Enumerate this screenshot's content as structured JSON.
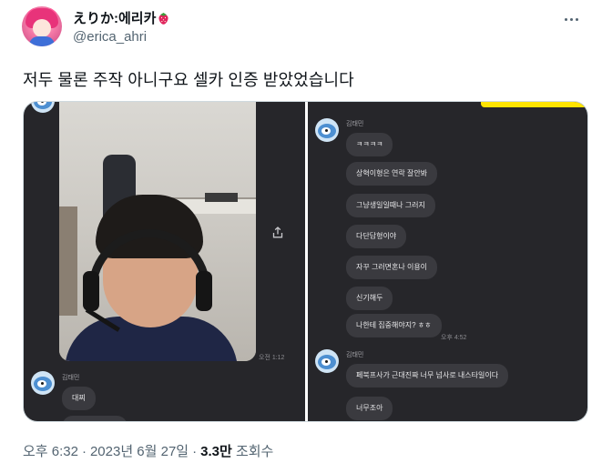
{
  "author": {
    "display_name": "えりか:에리카",
    "handle": "@erica_ahri"
  },
  "tweet": {
    "text": "저두 물론 주작 아니구요 셀카 인증 받았었습니다"
  },
  "media": {
    "left_panel": {
      "photo_timestamp": "오전 1:12",
      "sender_name": "김태민",
      "bubbles": [
        "대찌"
      ]
    },
    "right_panel": {
      "first_sender_name": "김태민",
      "first_group": [
        "ㅋㅋㅋㅋ",
        "상혁이형은 연락 잘안봐",
        "그냥생일일때나 그러지",
        "다단답형이야",
        "자꾸 그러면혼나 이용이",
        "신기해두",
        "나한테 집중해야지? ㅎㅎ"
      ],
      "first_group_time": "오후 4:52",
      "second_sender_name": "김태민",
      "second_group": [
        "페북프사가 근대진짜 너무 넘사로 내스타일이다",
        "너무조아"
      ]
    }
  },
  "footer": {
    "time": "오후 6:32",
    "date": "2023년 6월 27일",
    "views_count": "3.3만",
    "views_label": "조회수"
  },
  "colors": {
    "accent_yellow": "#ffe400",
    "chat_bg": "#26262a",
    "bubble_bg": "#3a3a3f",
    "secondary_text": "#536471"
  },
  "icons": [
    "strawberry-emoji",
    "more-icon",
    "share-icon"
  ]
}
